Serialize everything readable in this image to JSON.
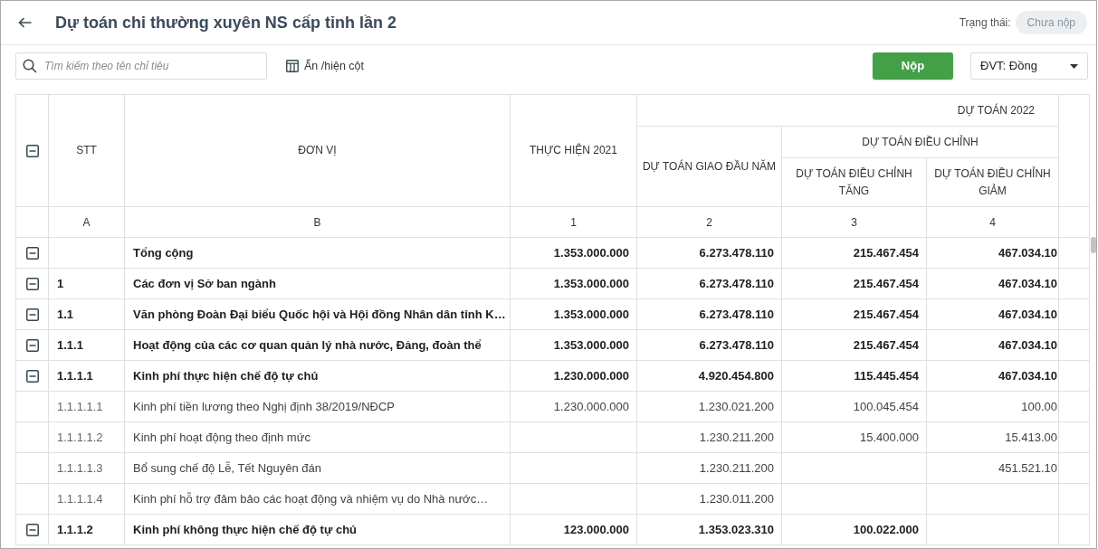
{
  "header": {
    "title": "Dự toán chi thường xuyên NS cấp tỉnh lần 2",
    "status_label": "Trạng thái:",
    "status": "Chưa nộp"
  },
  "toolbar": {
    "search": {
      "placeholder": "Tìm kiếm theo tên chỉ tiêu"
    },
    "column_toggle": "Ẩn /hiện cột",
    "submit_button": "Nộp",
    "unit_select": "ĐVT: Đồng"
  },
  "table": {
    "all_expanded": true,
    "columns": [
      "STT",
      "ĐƠN VỊ",
      "THỰC HIỆN 2021",
      "DỰ TOÁN GIAO ĐẦU NĂM",
      "DỰ TOÁN ĐIỀU CHỈNH TĂNG",
      "DỰ TOÁN ĐIỀU CHỈNH GIẢM"
    ],
    "column_groups": [
      "DỰ TOÁN 2022",
      "DỰ TOÁN ĐIỀU CHỈNH"
    ],
    "column_codes": [
      "A",
      "B",
      "1",
      "2",
      "3",
      "4"
    ],
    "rows": [
      {
        "kind": "group",
        "expanded": true,
        "name": "Tổng cộng",
        "values": {
          "actual_2021": "1.353.000.000",
          "initial_estimate": "6.273.478.110",
          "increase": "215.467.454",
          "decrease": "467.034.10"
        },
        "children": [
          {
            "kind": "group",
            "expanded": true,
            "stt": "1",
            "name": "Các đơn vị Sở ban ngành",
            "values": {
              "actual_2021": "1.353.000.000",
              "initial_estimate": "6.273.478.110",
              "increase": "215.467.454",
              "decrease": "467.034.10"
            },
            "children": [
              {
                "kind": "group",
                "expanded": true,
                "stt": "1.1",
                "name": "Văn phòng Đoàn Đại biểu Quốc hội và Hội đồng Nhân dân tỉnh K…",
                "values": {
                  "actual_2021": "1.353.000.000",
                  "initial_estimate": "6.273.478.110",
                  "increase": "215.467.454",
                  "decrease": "467.034.10"
                },
                "children": [
                  {
                    "kind": "group",
                    "expanded": true,
                    "stt": "1.1.1",
                    "name": "Hoạt động của các cơ quan quản lý nhà nước, Đảng, đoàn thể",
                    "values": {
                      "actual_2021": "1.353.000.000",
                      "initial_estimate": "6.273.478.110",
                      "increase": "215.467.454",
                      "decrease": "467.034.10"
                    },
                    "children": [
                      {
                        "kind": "group",
                        "expanded": true,
                        "stt": "1.1.1.1",
                        "name": "Kinh phí thực hiện chế độ tự chủ",
                        "values": {
                          "actual_2021": "1.230.000.000",
                          "initial_estimate": "4.920.454.800",
                          "increase": "115.445.454",
                          "decrease": "467.034.10"
                        },
                        "children": [
                          {
                            "kind": "item",
                            "stt": "1.1.1.1.1",
                            "name": "Kinh phí tiền lương theo Nghị định 38/2019/NĐCP",
                            "values": {
                              "actual_2021": "1.230.000.000",
                              "initial_estimate": "1.230.021.200",
                              "increase": "100.045.454",
                              "decrease": "100.00"
                            }
                          },
                          {
                            "kind": "item",
                            "stt": "1.1.1.1.2",
                            "name": "Kinh phí hoạt động theo định mức",
                            "values": {
                              "initial_estimate": "1.230.211.200",
                              "increase": "15.400.000",
                              "decrease": "15.413.00"
                            }
                          },
                          {
                            "kind": "item",
                            "stt": "1.1.1.1.3",
                            "name": "Bổ sung chế độ Lễ, Tết Nguyên đán",
                            "values": {
                              "initial_estimate": "1.230.211.200",
                              "decrease": "451.521.10"
                            }
                          },
                          {
                            "kind": "item",
                            "stt": "1.1.1.1.4",
                            "name": "Kinh phí hỗ trợ đảm bảo các hoạt động và nhiệm vụ do Nhà nước…",
                            "values": {
                              "initial_estimate": "1.230.011.200"
                            }
                          }
                        ]
                      },
                      {
                        "kind": "group",
                        "expanded": true,
                        "stt": "1.1.1.2",
                        "name": "Kinh phí không thực hiện chế độ tự chủ",
                        "values": {
                          "actual_2021": "123.000.000",
                          "initial_estimate": "1.353.023.310",
                          "increase": "100.022.000"
                        }
                      }
                    ]
                  }
                ]
              }
            ]
          }
        ]
      }
    ]
  }
}
